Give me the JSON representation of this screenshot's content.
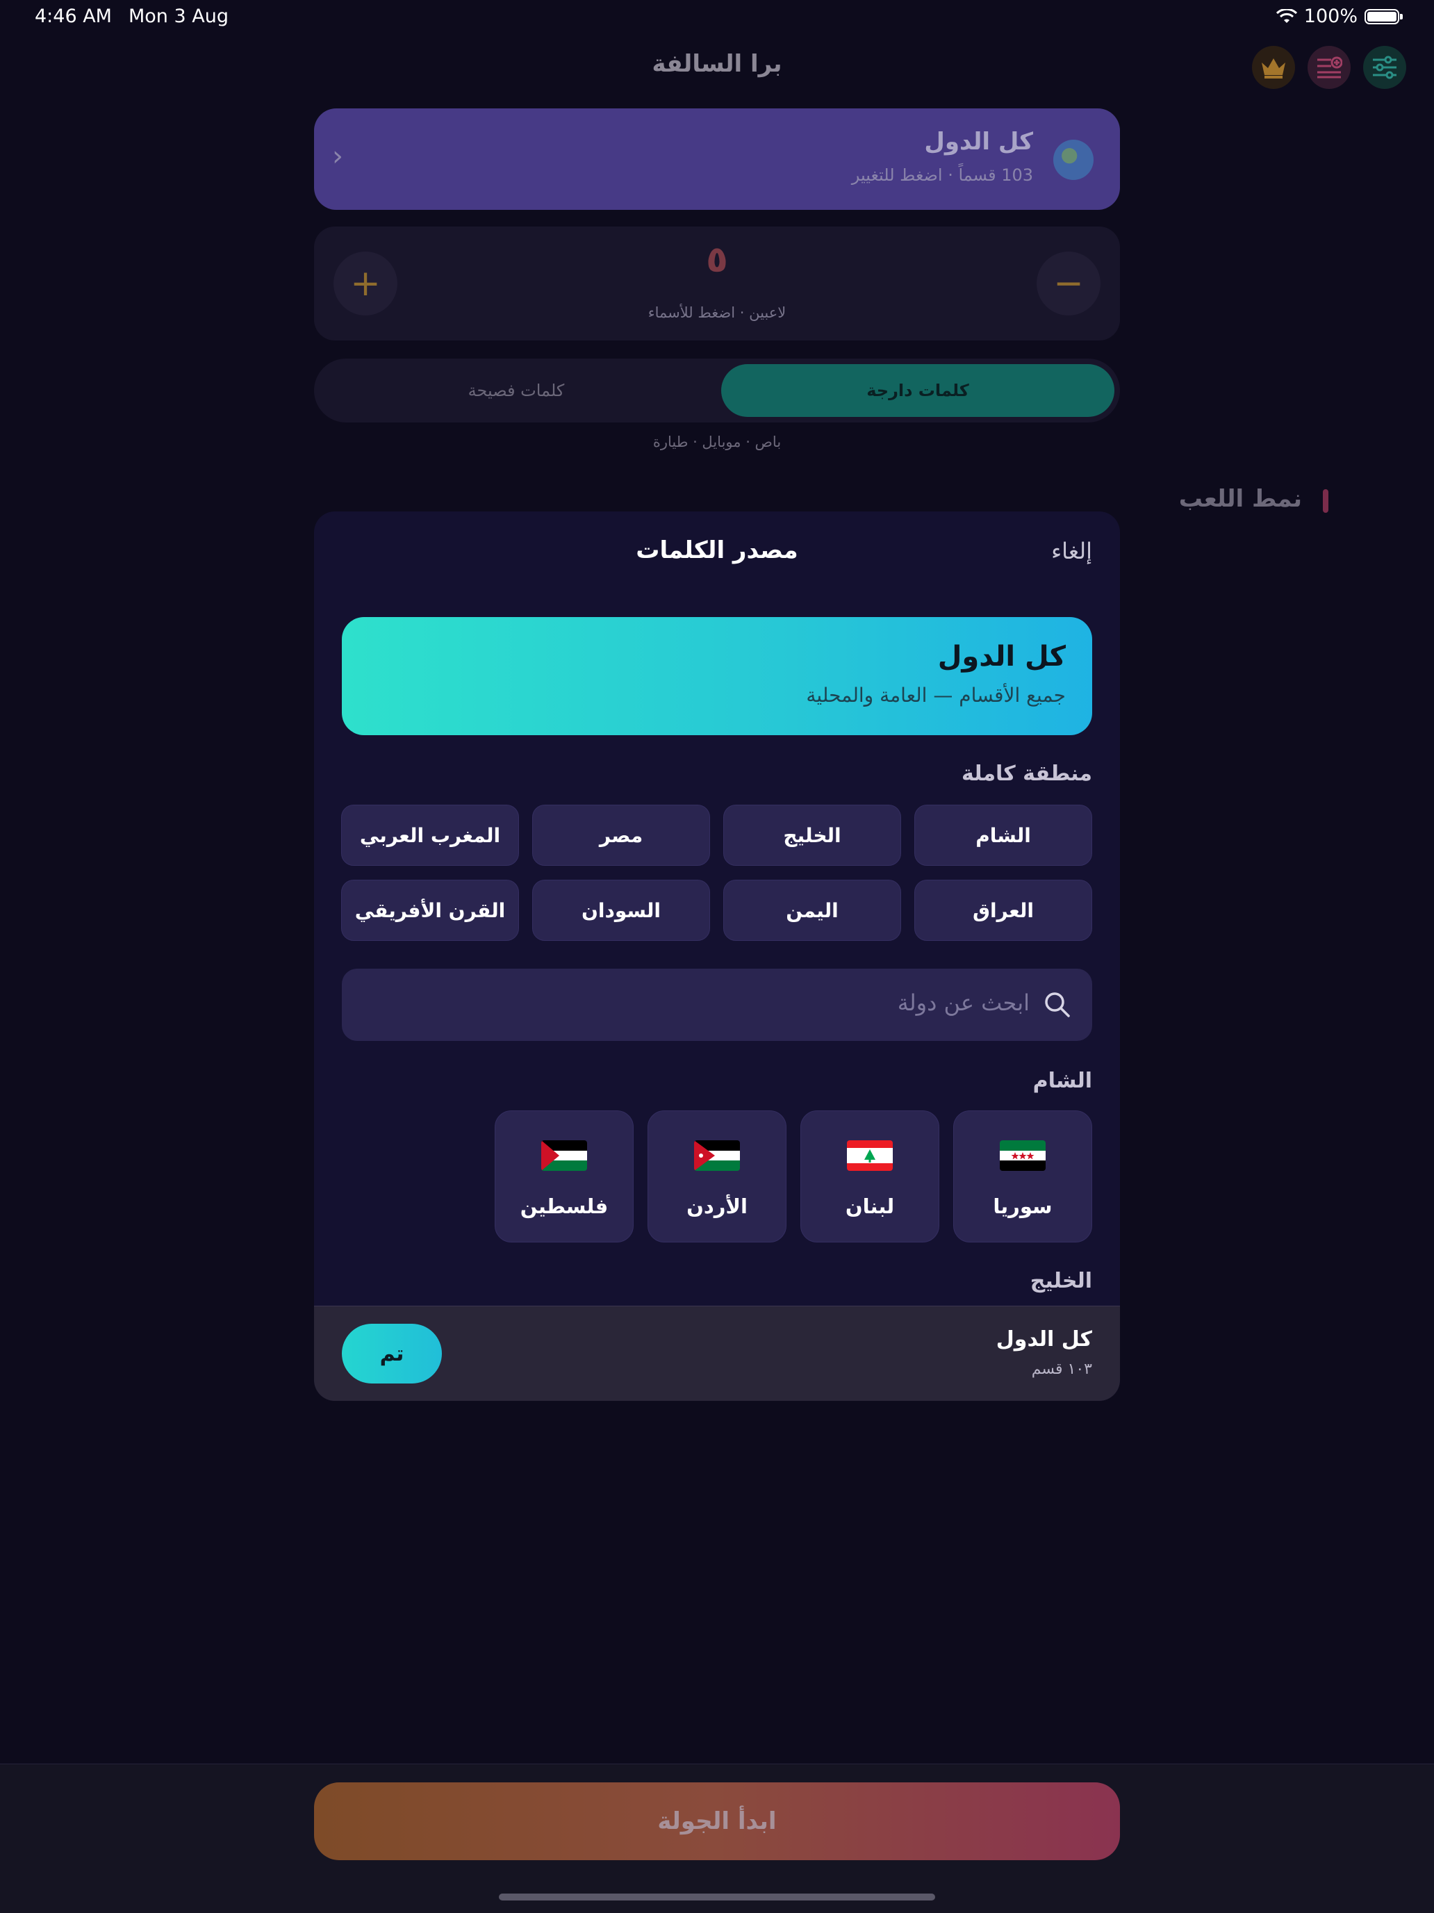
{
  "status_bar": {
    "time": "4:46 AM",
    "date": "Mon 3 Aug",
    "battery": "100%"
  },
  "app": {
    "title": "برا السالفة"
  },
  "header_icons": [
    "settings-sliders-icon",
    "playlist-add-icon",
    "crown-icon"
  ],
  "region_card": {
    "title": "كل الدول",
    "subtitle": "103 قسماً · اضغط للتغيير"
  },
  "players": {
    "count": "٥",
    "hint": "لاعبين · اضغط للأسماء",
    "minus": "−",
    "plus": "+"
  },
  "word_type": {
    "selected": "كلمات دارجة",
    "other": "كلمات فصيحة",
    "examples": "باص · موبايل · طيارة"
  },
  "game_mode_label": "نمط اللعب",
  "sheet": {
    "title": "مصدر الكلمات",
    "cancel": "إلغاء",
    "all_option": {
      "title": "كل الدول",
      "subtitle": "جميع الأقسام — العامة والمحلية"
    },
    "region_section_label": "منطقة كاملة",
    "regions": [
      "الشام",
      "الخليج",
      "مصر",
      "المغرب العربي",
      "العراق",
      "اليمن",
      "السودان",
      "القرن الأفريقي"
    ],
    "search_placeholder": "ابحث عن دولة",
    "groups": [
      {
        "label": "الشام",
        "countries": [
          {
            "name": "سوريا",
            "flag": "syria-flag"
          },
          {
            "name": "لبنان",
            "flag": "lebanon-flag"
          },
          {
            "name": "الأردن",
            "flag": "jordan-flag"
          },
          {
            "name": "فلسطين",
            "flag": "palestine-flag"
          }
        ]
      },
      {
        "label": "الخليج",
        "countries": []
      }
    ],
    "footer": {
      "title": "كل الدول",
      "subtitle": "١٠٣ قسم",
      "done": "تم"
    }
  },
  "start_button": "ابدأ الجولة",
  "colors": {
    "accent_teal": "#2ee0cc",
    "accent_blue": "#1fb3e3",
    "sheet_bg": "#141130",
    "chip_bg": "#2a2550"
  }
}
